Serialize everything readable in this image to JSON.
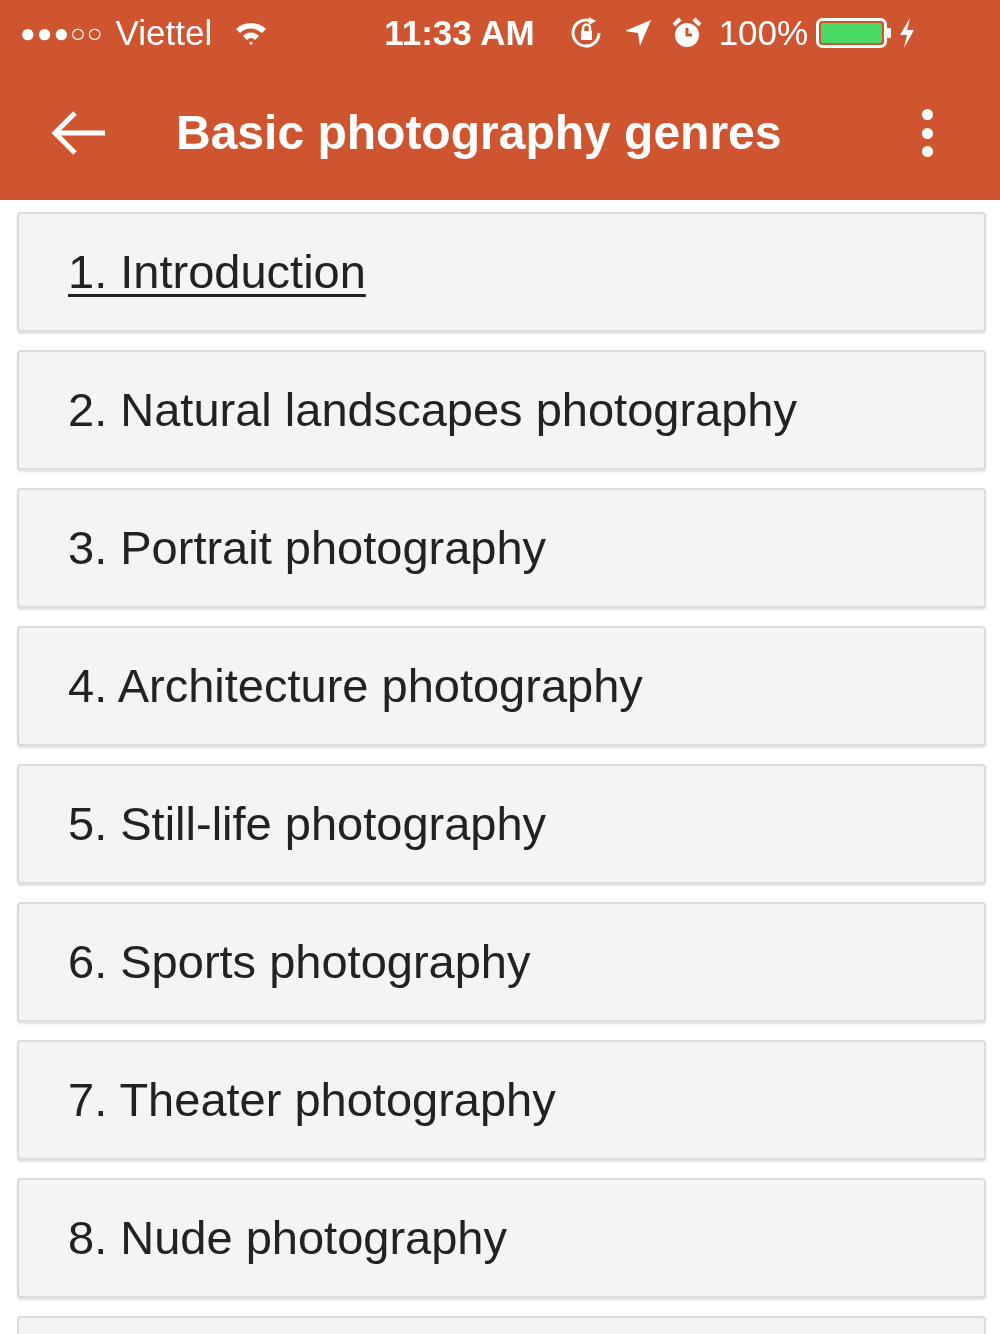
{
  "status_bar": {
    "signal_bars": "●●●○○",
    "carrier": "Viettel",
    "time": "11:33 AM",
    "battery": "100%",
    "battery_meter": {
      "level": 1
    }
  },
  "toolbar": {
    "title": "Basic photography genres"
  },
  "items": [
    {
      "label": "1. Introduction",
      "selected": true
    },
    {
      "label": "2. Natural landscapes photography",
      "selected": false
    },
    {
      "label": "3. Portrait photography",
      "selected": false
    },
    {
      "label": "4. Architecture photography",
      "selected": false
    },
    {
      "label": "5. Still-life photography",
      "selected": false
    },
    {
      "label": "6. Sports photography",
      "selected": false
    },
    {
      "label": "7. Theater photography",
      "selected": false
    },
    {
      "label": "8. Nude photography",
      "selected": false
    }
  ]
}
